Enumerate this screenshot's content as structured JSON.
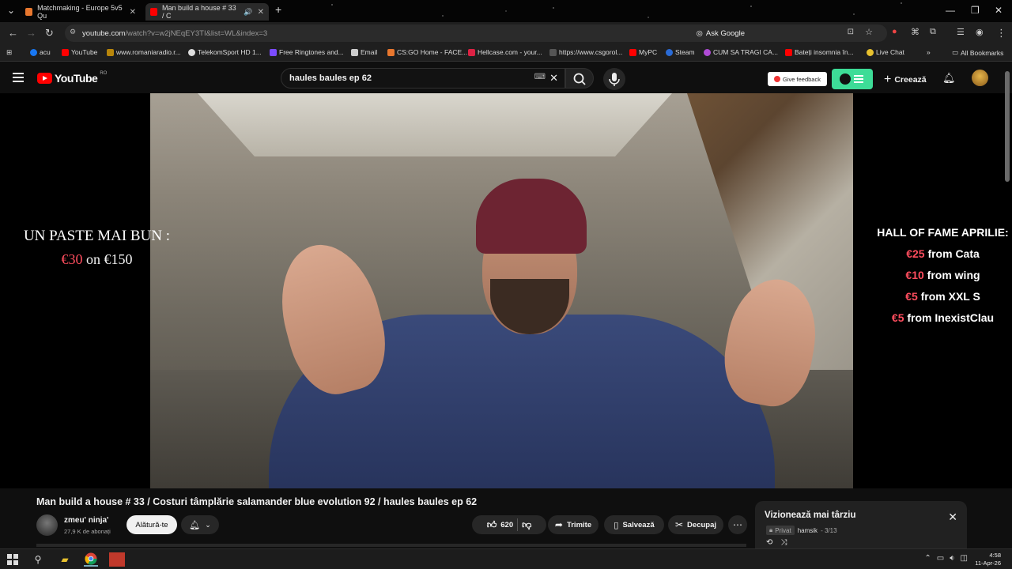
{
  "browser": {
    "tabs": [
      {
        "label": "Matchmaking - Europe 5v5 Qu",
        "active": false
      },
      {
        "label": "Man build a house # 33 / C",
        "active": true
      }
    ],
    "url_host": "youtube.com",
    "url_path": "/watch?v=w2jNEqEY3TI&list=WL&index=3",
    "ask_google": "Ask Google",
    "bookmarks": [
      "acu",
      "YouTube",
      "www.romaniaradio.r...",
      "TelekomSport HD 1...",
      "Free Ringtones and...",
      "Email",
      "CS:GO Home - FACE...",
      "Hellcase.com - your...",
      "https://www.csgorol...",
      "MyPC",
      "Steam",
      "CUM SA TRAGI CA...",
      "Bateți insomnia în...",
      "Live Chat"
    ],
    "all_bookmarks": "All Bookmarks"
  },
  "youtube": {
    "logo": "YouTube",
    "country": "RO",
    "search_query": "haules baules ep 62",
    "give_feedback": "Give feedback",
    "create_label": "Creează"
  },
  "video": {
    "overlay_left_title": "UN PASTE MAI BUN :",
    "overlay_left_amount": "€30",
    "overlay_left_on": "on",
    "overlay_left_goal": "€150",
    "hall_title": "HALL OF FAME APRILIE:",
    "hall": [
      {
        "amount": "€25",
        "from": "from Cata"
      },
      {
        "amount": "€10",
        "from": "from wing"
      },
      {
        "amount": "€5",
        "from": "from XXL S"
      },
      {
        "amount": "€5",
        "from": "from InexistClau"
      }
    ],
    "title": "Man build a house # 33 / Costuri tâmplărie salamander blue evolution 92 / haules baules ep 62",
    "channel": "zmeu' ninja'",
    "subscribers": "27,9 K de abonați",
    "join": "Alătură-te",
    "likes": "620",
    "share": "Trimite",
    "save": "Salvează",
    "clip": "Decupaj"
  },
  "playlist": {
    "title": "Vizionează mai târziu",
    "privacy": "Privat",
    "owner": "hamsik",
    "position": "- 3/13"
  },
  "taskbar": {
    "time": "4:58",
    "date": "11-Apr-26"
  },
  "colors": {
    "yt_red": "#ff0000",
    "accent_green": "#3ddc97",
    "overlay_red": "#ff4d5e"
  }
}
